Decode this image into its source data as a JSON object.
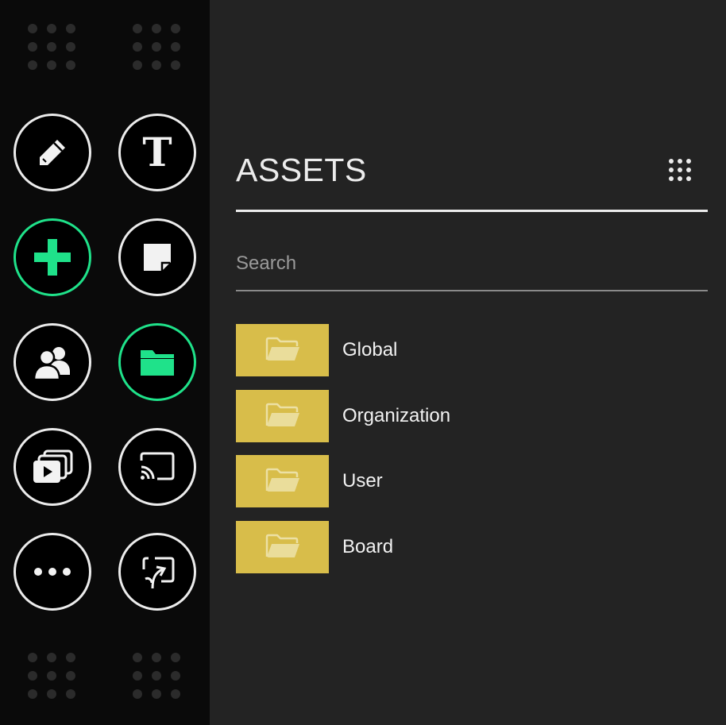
{
  "colors": {
    "sidebar_bg": "#0a0a0a",
    "panel_bg": "#232323",
    "accent": "#1fe28a",
    "folder_tile": "#d8bd4a",
    "text": "#ececec"
  },
  "toolbar": {
    "tools": [
      {
        "name": "pen",
        "icon": "pencil-icon",
        "active": false
      },
      {
        "name": "text",
        "icon": "text-icon",
        "glyph": "T",
        "active": false
      },
      {
        "name": "add",
        "icon": "plus-icon",
        "active": true
      },
      {
        "name": "sticky-note",
        "icon": "sticky-note-icon",
        "active": false
      },
      {
        "name": "users",
        "icon": "users-icon",
        "active": false
      },
      {
        "name": "assets",
        "icon": "folder-icon",
        "active": true
      },
      {
        "name": "media",
        "icon": "media-play-icon",
        "active": false
      },
      {
        "name": "cast",
        "icon": "cast-icon",
        "active": false
      },
      {
        "name": "more",
        "icon": "more-icon",
        "active": false
      },
      {
        "name": "share-screen",
        "icon": "share-screen-icon",
        "active": false
      }
    ]
  },
  "assets_panel": {
    "title": "ASSETS",
    "search_placeholder": "Search",
    "menu_icon": "grid-menu-icon",
    "folders": [
      {
        "label": "Global",
        "icon": "open-folder-icon"
      },
      {
        "label": "Organization",
        "icon": "open-folder-icon"
      },
      {
        "label": "User",
        "icon": "open-folder-icon"
      },
      {
        "label": "Board",
        "icon": "open-folder-icon"
      }
    ]
  }
}
